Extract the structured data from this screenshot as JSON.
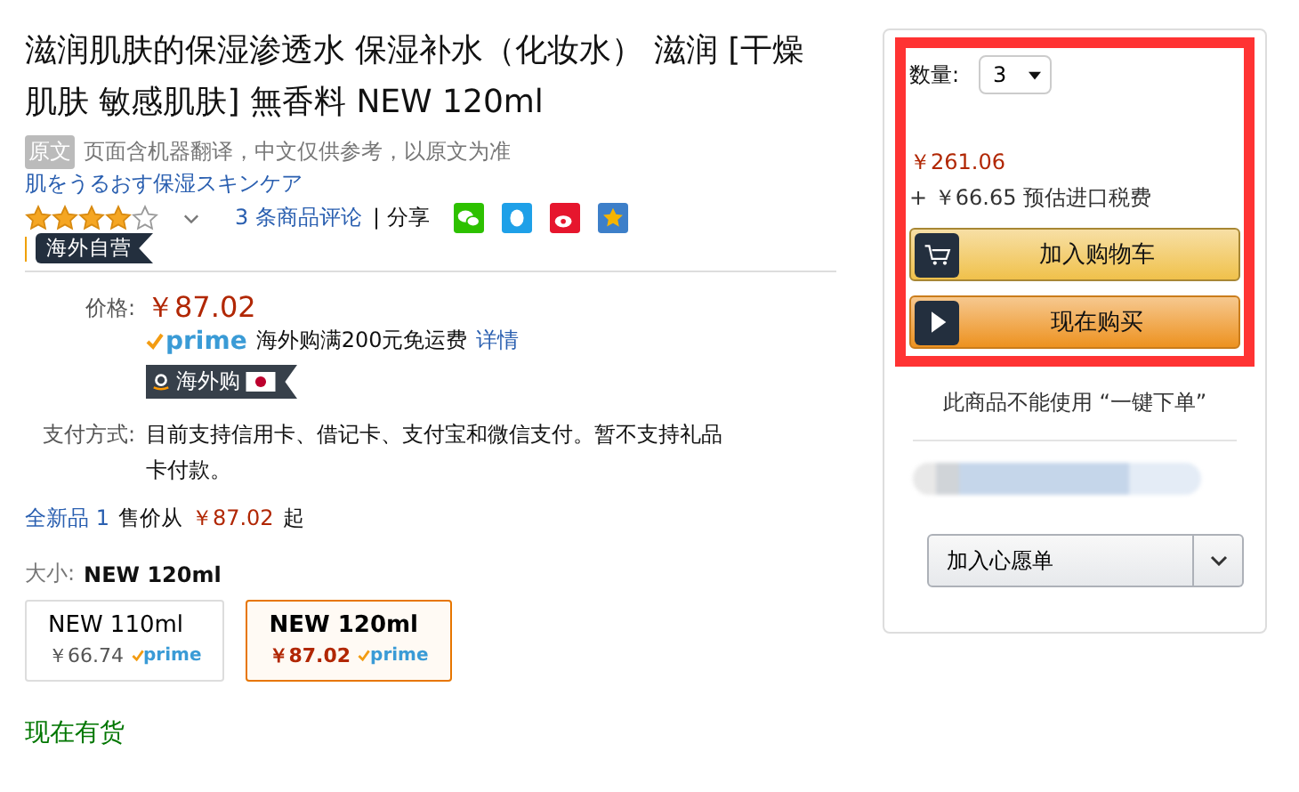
{
  "product": {
    "title": "滋润肌肤的保湿渗透水 保湿补水（化妆水） 滋润 [干燥肌肤 敏感肌肤] 無香料 NEW 120ml",
    "translation_badge": "原文",
    "translation_note": "页面含机器翻译，中文仅供参考，以原文为准",
    "original_title": "肌をうるおす保湿スキンケア",
    "rating": {
      "stars": 4,
      "reviews": "3 条商品评论",
      "share_label": "| 分享"
    },
    "seller_badge": "海外自营"
  },
  "price": {
    "label": "价格:",
    "value": "￥87.02",
    "prime_logo": "prime",
    "shipping_note": "海外购满200元免运费",
    "details_link": "详情",
    "store_badge": "海外购"
  },
  "payment": {
    "label": "支付方式:",
    "text": "目前支持信用卡、借记卡、支付宝和微信支付。暂不支持礼品卡付款。"
  },
  "offers": {
    "link": "全新品 1",
    "text": "售价从",
    "price": "￥87.02",
    "suffix": "起"
  },
  "size": {
    "label": "大小:",
    "value": "NEW 120ml",
    "options": [
      {
        "name": "NEW 110ml",
        "price": "￥66.74",
        "prime": "prime",
        "selected": false
      },
      {
        "name": "NEW 120ml",
        "price": "￥87.02",
        "prime": "prime",
        "selected": true
      }
    ]
  },
  "availability": "现在有货",
  "buy_box": {
    "quantity_label": "数量:",
    "quantity": "3",
    "total": "￥261.06",
    "tax_note": "+ ￥66.65 预估进口税费",
    "highlighted": true,
    "buttons": [
      {
        "kind": "cart",
        "label": "加入购物车"
      },
      {
        "kind": "buy",
        "label": "现在购买"
      }
    ],
    "one_click_note": "此商品不能使用 “一键下单”",
    "wishlist": "加入心愿单"
  }
}
